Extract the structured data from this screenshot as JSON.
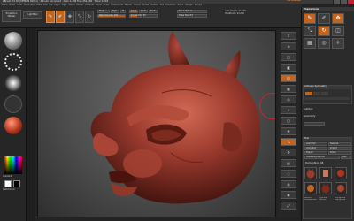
{
  "titlebar": {
    "title": "ZBrush 3.5 R3 [DEMON SKULL] : ZBrush Document   ·  Mem 1,138 Free 452,196  ·  Timer 0.093",
    "accent_text": "AUTOSAVE"
  },
  "menus": [
    "Alpha",
    "Brush",
    "Color",
    "Document",
    "Draw",
    "Edit",
    "File",
    "Layer",
    "Light",
    "Macro",
    "Marker",
    "Material",
    "Movie",
    "Picker",
    "Preferences",
    "Render",
    "Stencil",
    "Stroke",
    "Texture",
    "Tool",
    "Transform",
    "Zoom",
    "Zplugin",
    "Zscript"
  ],
  "topshelf": {
    "projection_master": "Projection Master",
    "lightbox": "LightBox",
    "buttons": [
      {
        "name": "edit",
        "label": "Edit",
        "on": true
      },
      {
        "name": "draw",
        "label": "Draw",
        "on": true
      },
      {
        "name": "move",
        "label": "Move",
        "on": false
      },
      {
        "name": "scale",
        "label": "Scale",
        "on": false
      },
      {
        "name": "rotate",
        "label": "Rotate",
        "on": false
      }
    ],
    "mrgb": "Mrgb",
    "rgb": "Rgb",
    "m": "M",
    "zadd": "Zadd",
    "zsub": "Zsub",
    "zcut": "Zcut",
    "focal_shift": "Focal Shift 0",
    "draw_size": "Draw Size 64",
    "rgb_intensity": "Rgb Intensity 100",
    "z_intensity": "Z Intensity 25",
    "active_points": "ActivePoints: 93,248",
    "total_points": "TotalPoints: 94,486",
    "rgb_intensity_level": 1.0,
    "z_intensity_level": 0.25
  },
  "right": {
    "title": "Transform",
    "activate_symmetry": "Activate Symmetry",
    "subtool": "SubTool",
    "geometry": "Geometry",
    "tool": "Tool",
    "load_tool": "Load Tool",
    "save_as": "Save As",
    "copy_tool": "Copy Tool",
    "import": "Import",
    "export": "Export",
    "clone": "Clone",
    "make_polymesh": "Make PolyMesh3D",
    "goz": "GoZ",
    "demon_label": "DemonSkull 48",
    "thumb_labels": [
      "Demon",
      "Cylinder",
      "PolySphere",
      "SimpleBrush",
      "Demon",
      "PolySphere"
    ]
  },
  "lefttray": {
    "gradient_label": "Gradient",
    "switch_color": "SwitchColor"
  },
  "colors": {
    "accent": "#c1641f",
    "model": "#9b3a2e"
  },
  "icons": {
    "vstrip": [
      "scroll-icon",
      "zoom-icon",
      "actual-icon",
      "aahalf-icon",
      "persp-icon",
      "floor-icon",
      "local-icon",
      "xyz-icon",
      "frame-icon",
      "move-icon",
      "scale-icon",
      "rotate-icon",
      "polyf-icon",
      "transp-icon",
      "ghost-icon",
      "solo-icon",
      "xpose-icon"
    ]
  }
}
